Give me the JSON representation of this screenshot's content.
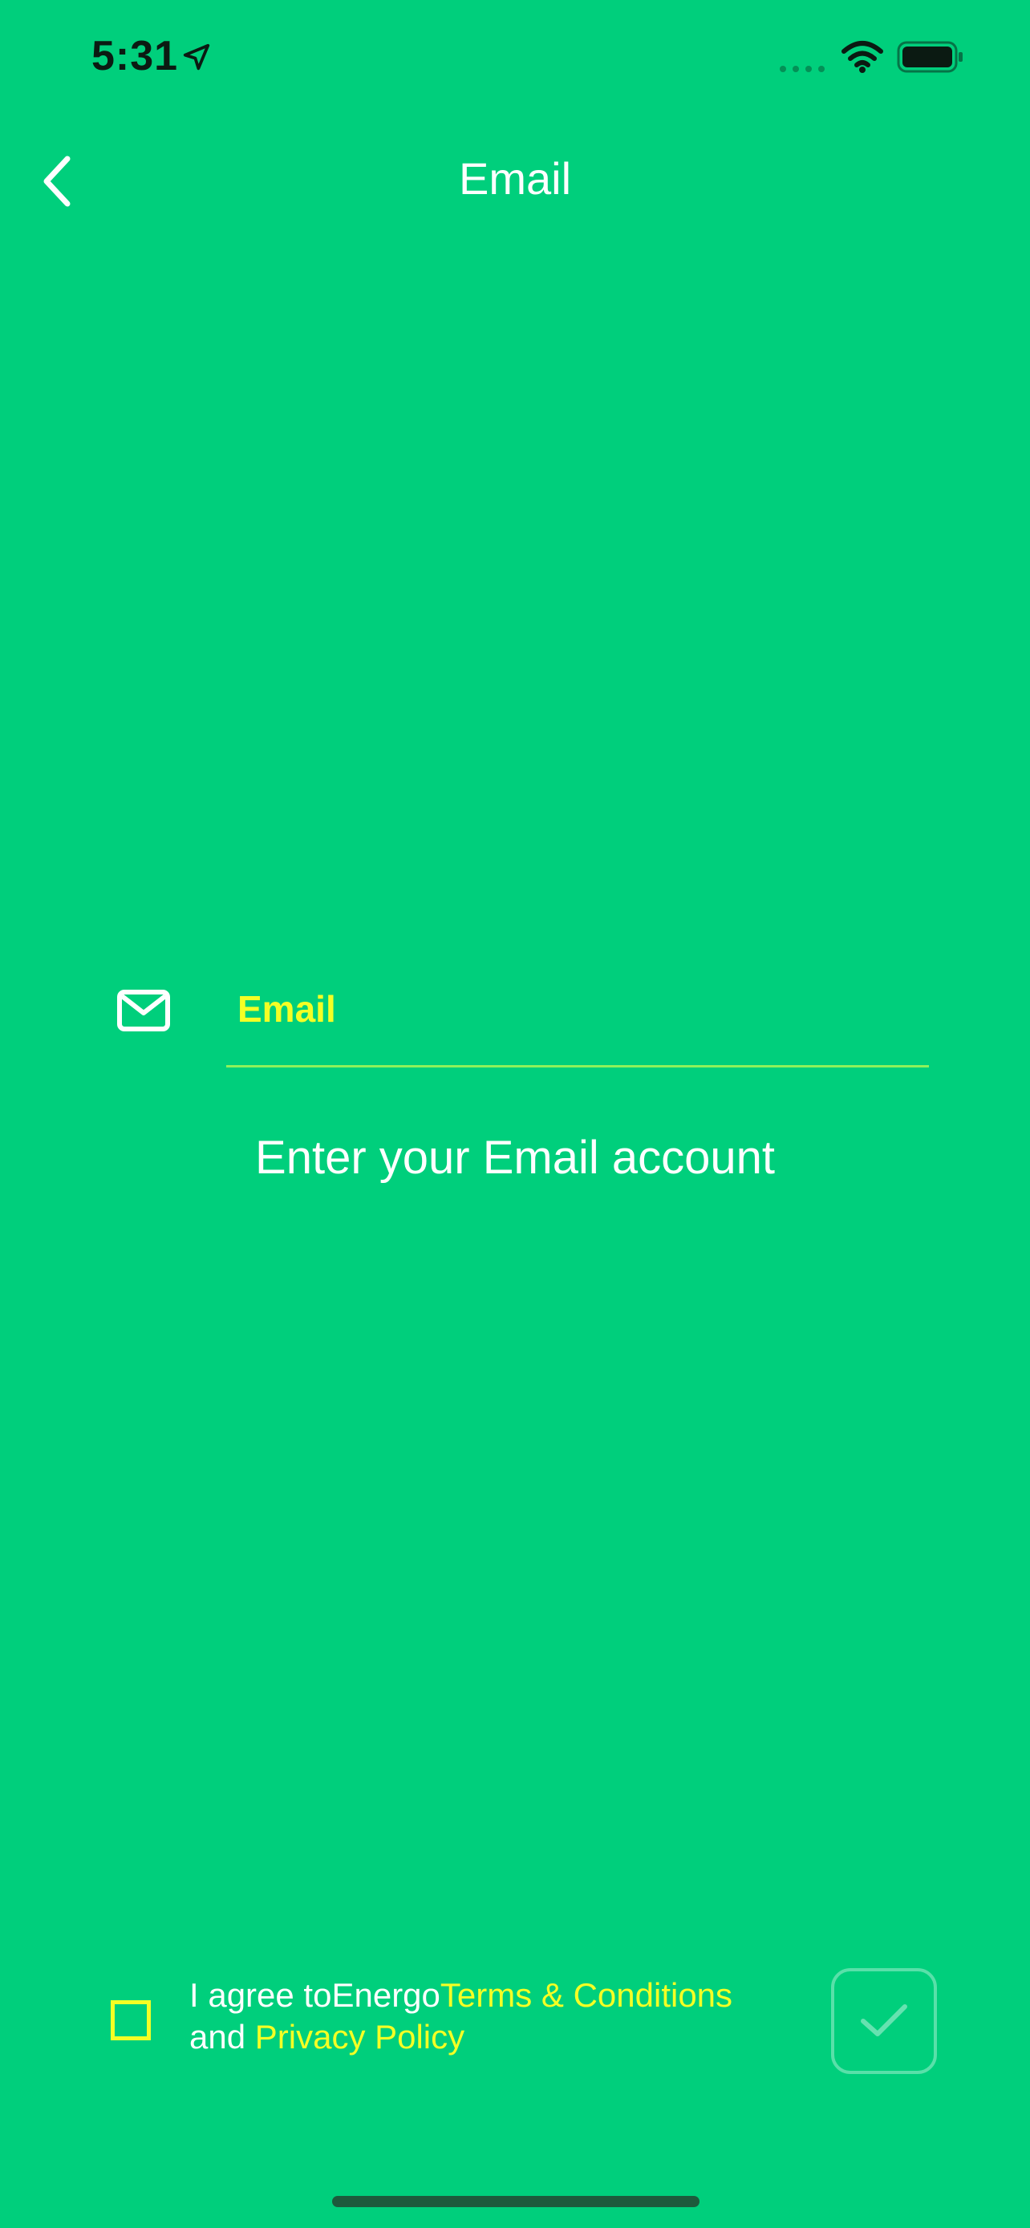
{
  "status_bar": {
    "time": "5:31",
    "icons": [
      "location-arrow-icon",
      "signal-icon",
      "wifi-icon",
      "battery-icon"
    ]
  },
  "nav": {
    "back_icon": "chevron-left-icon",
    "title": "Email"
  },
  "email_field": {
    "icon": "mail-icon",
    "placeholder": "Email",
    "value": ""
  },
  "hint": "Enter your Email account",
  "agreement": {
    "prefix": "I agree to",
    "brand": "Energo",
    "terms_label": "Terms & Conditions",
    "conjunction": "and",
    "privacy_label": "Privacy Policy",
    "checked": false,
    "confirm_icon": "check-icon"
  },
  "colors": {
    "background": "#00cf7c",
    "accent": "#f4ff24",
    "underline": "#8ff25a",
    "text": "#ffffff"
  }
}
